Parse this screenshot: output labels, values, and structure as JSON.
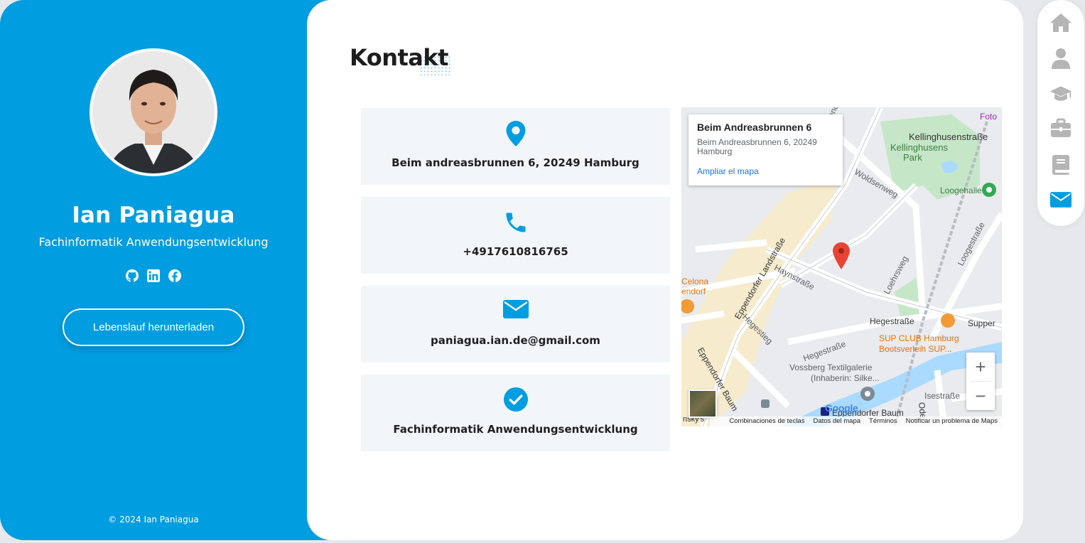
{
  "profile": {
    "name": "Ian Paniagua",
    "role": "Fachinformatik Anwendungsentwicklung",
    "cv_button": "Lebenslauf herunterladen",
    "copyright": "© 2024 Ian Paniagua",
    "socials": [
      "github-icon",
      "linkedin-icon",
      "facebook-icon"
    ]
  },
  "main": {
    "title": "Kontakt",
    "cards": [
      {
        "icon": "location-pin-icon",
        "text": "Beim andreasbrunnen 6, 20249 Hamburg"
      },
      {
        "icon": "phone-icon",
        "text": "+4917610816765"
      },
      {
        "icon": "envelope-icon",
        "text": "paniagua.ian.de@gmail.com"
      },
      {
        "icon": "check-circle-icon",
        "text": "Fachinformatik Anwendungsentwicklung"
      }
    ]
  },
  "map": {
    "place_title": "Beim Andreasbrunnen 6",
    "place_address": "Beim Andreasbrunnen 6, 20249 Hamburg",
    "expand_link": "Ampliar el mapa",
    "zoom_in": "+",
    "zoom_out": "−",
    "logo": "Google",
    "footer": [
      "Combinaciones de teclas",
      "Datos del mapa",
      "Términos",
      "Notificar un problema de Maps"
    ],
    "labels": {
      "kellinghusenstrasse": "Kellinghusenstraße",
      "kellinghusens_park_1": "Kellinghusens",
      "kellinghusens_park_2": "Park",
      "loogehalle": "Loogehalle",
      "woldsenweg": "Woldsenweg",
      "eppendorfer_landstrasse": "Eppendorfer Landstraße",
      "haynstrasse": "Haynstraße",
      "loehrsweg": "Loehrsweg",
      "loogestrasse": "Loogestraße",
      "hegestrasse": "Hegestraße",
      "hegestrasse2": "Hegestraße",
      "hegestieg": "Hegestieg",
      "sup_club_1": "SUP CLUB Hamburg",
      "sup_club_2": "Bootsverleih SUP...",
      "vossberg_1": "Vossberg Textilgalerie",
      "vossberg_2": "(Inhaberin: Silke...",
      "eppendorfer_baum": "Eppendorfer Baum",
      "eppendorfer_baum2": "Eppendorfer Baum",
      "isestrasse": "Isestraße",
      "supper": "Supper",
      "celona_1": "Celona",
      "celona_2": "endorf",
      "foto": "Foto",
      "oder": "Oder",
      "eppendorfer_l": "Eppendorfer L",
      "insky": "nsky's"
    }
  },
  "nav": {
    "items": [
      {
        "name": "home-icon",
        "color": "#b5b5b5"
      },
      {
        "name": "user-icon",
        "color": "#b5b5b5"
      },
      {
        "name": "graduation-cap-icon",
        "color": "#b5b5b5"
      },
      {
        "name": "briefcase-icon",
        "color": "#b5b5b5"
      },
      {
        "name": "book-icon",
        "color": "#b5b5b5"
      },
      {
        "name": "envelope-icon",
        "color": "#009de0"
      }
    ]
  },
  "colors": {
    "accent": "#009de0",
    "card_bg": "#f2f6f9",
    "nav_inactive": "#b5b5b5"
  }
}
